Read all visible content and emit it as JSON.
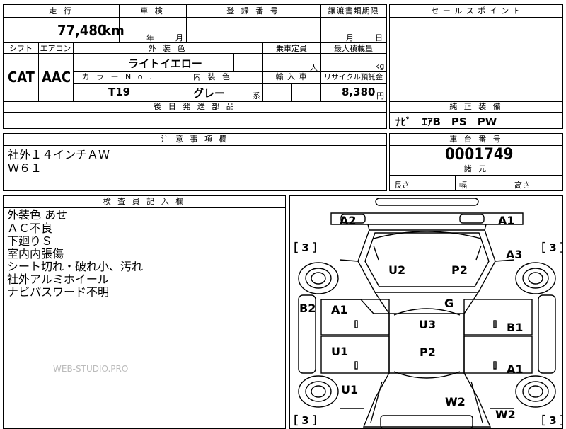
{
  "top": {
    "mileage_header": "走 行",
    "shaken_header": "車 検",
    "registration_header": "登 録 番 号",
    "transfer_header": "譲渡書類期限",
    "mileage_value": "77,480",
    "mileage_unit": "km",
    "shaken_year": "年",
    "shaken_month": "月",
    "transfer_month": "月",
    "transfer_day": "日"
  },
  "sales_point": {
    "header": "セ ー ル ス ポ イ ン ト"
  },
  "spec": {
    "shift_header": "シフト",
    "aircon_header": "エアコン",
    "exterior_header": "外 装 色",
    "capacity_header": "乗車定員",
    "max_load_header": "最大積載量",
    "shift": "CAT",
    "aircon": "AAC",
    "exterior_color": "ライトイエロー",
    "capacity_unit": "人",
    "load_unit": "kg",
    "color_no_header": "カ ラ ー N o .",
    "interior_header": "内 装 色",
    "import_header": "輸 入 車",
    "recycle_header": "リサイクル預託金",
    "color_no": "T19",
    "interior_color": "グレー",
    "interior_suffix": "系",
    "recycle_fee": "8,380",
    "recycle_unit": "円"
  },
  "later_parts": {
    "header": "後 日 発 送 部 品"
  },
  "equipment": {
    "header": "純 正 装 備",
    "value": "ﾅﾋﾞ　ｴｱB　PS　PW"
  },
  "caution": {
    "header": "注 意 事 項 欄",
    "lines": [
      "社外１４インチＡＷ",
      "Ｗ６１"
    ]
  },
  "chassis": {
    "header": "車 台 番 号",
    "number": "0001749",
    "dims_header": "諸 元",
    "length": "長さ",
    "width": "幅",
    "height": "高さ"
  },
  "inspector": {
    "header": "検 査 員 記 入 欄",
    "lines": [
      "外装色 あせ",
      "ＡＣ不良",
      "下廻りＳ",
      "室内内張傷",
      "シート切れ・破れ小、汚れ",
      "社外アルミホイール",
      "ナビパスワード不明"
    ]
  },
  "diagram": {
    "labels": {
      "a2": "A2",
      "a1_top": "A1",
      "a3": "A3",
      "u2": "U2",
      "p2_front": "P2",
      "g": "G",
      "b2": "B2",
      "a1_left": "A1",
      "u3": "U3",
      "b1": "B1",
      "u1_left": "U1",
      "p2_mid": "P2",
      "a1_right": "A1",
      "u1_bottom": "U1",
      "w2_center": "W2",
      "w2_right": "W2"
    },
    "tires": {
      "tl": "［ 3 ］",
      "tr": "［ 3 ］",
      "bl": "［ 3 ］",
      "br": "［ 3 ］"
    }
  },
  "watermark": "WEB-STUDIO.PRO"
}
